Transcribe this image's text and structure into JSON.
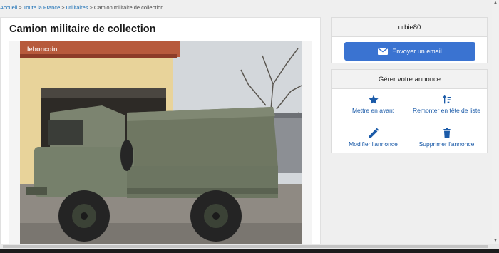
{
  "breadcrumb": {
    "home": "Accueil",
    "sep": ">",
    "region": "Toute la France",
    "category": "Utilitaires",
    "current": "Camion militaire de collection"
  },
  "listing": {
    "title": "Camion militaire de collection",
    "photo_watermark": "leboncoin"
  },
  "seller": {
    "name": "urbie80",
    "email_button": "Envoyer un email"
  },
  "manage": {
    "heading": "Gérer votre annonce",
    "actions": [
      {
        "label": "Mettre en avant",
        "icon": "star-icon"
      },
      {
        "label": "Remonter en tête de liste",
        "icon": "sort-up-icon"
      },
      {
        "label": "Modifier l'annonce",
        "icon": "pencil-icon"
      },
      {
        "label": "Supprimer l'annonce",
        "icon": "trash-icon"
      }
    ]
  },
  "colors": {
    "accent": "#3a73d1",
    "link": "#1a5aa8"
  }
}
